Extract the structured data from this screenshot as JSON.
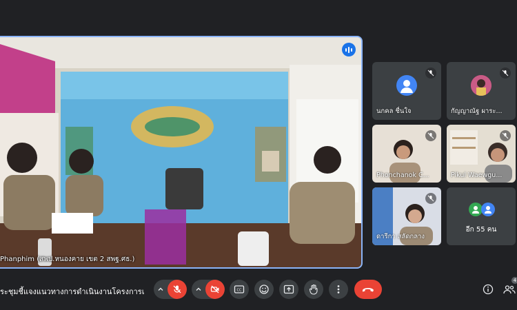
{
  "main": {
    "speaker_name": "Phanphim (สพป.หนองคาย เขต 2 สพฐ.ศธ.)",
    "banner_text": "สพป.หนองคาย เขต ๒"
  },
  "tiles": [
    {
      "name": "นกคล ชื่นใจ",
      "muted": true,
      "type": "avatar"
    },
    {
      "name": "กัญญาณัฐ ผาระ...",
      "muted": true,
      "type": "photo"
    },
    {
      "name": "Phonchanok C...",
      "muted": true,
      "type": "video"
    },
    {
      "name": "Pikul Waewgu...",
      "muted": true,
      "type": "video"
    },
    {
      "name": "ดารีกา สลัดกลาง",
      "muted": true,
      "type": "video"
    },
    {
      "name": "อีก 55 คน",
      "muted": false,
      "type": "others"
    }
  ],
  "bottom": {
    "meeting_title": "ระชุมชี้แจงแนวทางการดำเนินงานโครงการเสริ...",
    "participant_count": "4"
  },
  "colors": {
    "background": "#202124",
    "tile": "#3c4043",
    "active_border": "#8ab4f8",
    "danger": "#ea4335",
    "accent": "#1a73e8"
  },
  "icons": [
    "audio-level-icon",
    "mic-off-icon",
    "camera-off-icon",
    "captions-icon",
    "emoji-icon",
    "present-icon",
    "raise-hand-icon",
    "more-options-icon",
    "leave-call-icon",
    "info-icon",
    "people-icon",
    "chevron-up-icon"
  ]
}
